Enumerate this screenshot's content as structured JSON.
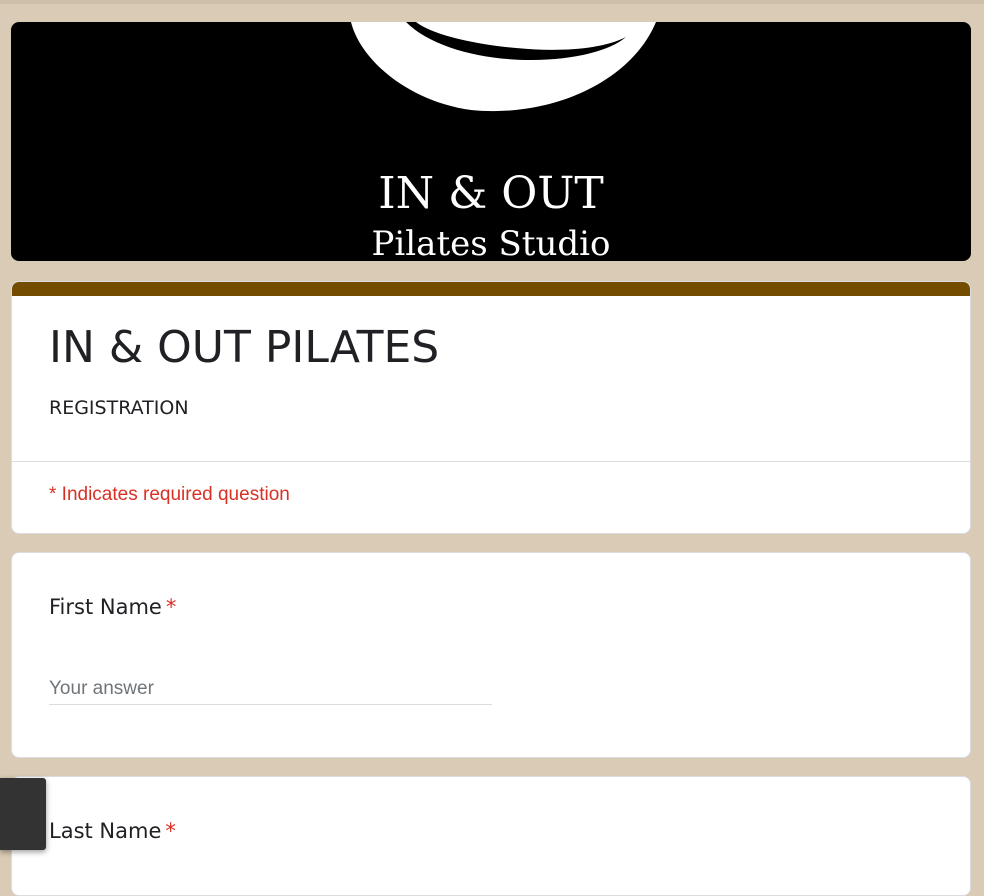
{
  "banner": {
    "line1": "IN & OUT",
    "line2": "Pilates Studio"
  },
  "form": {
    "title": "IN & OUT PILATES",
    "description": "REGISTRATION",
    "required_note": "* Indicates required question"
  },
  "questions": [
    {
      "label": "First Name",
      "required_mark": "*",
      "placeholder": "Your answer"
    },
    {
      "label": "Last Name",
      "required_mark": "*"
    }
  ],
  "colors": {
    "page_background": "#d9cbb5",
    "accent": "#744c00",
    "required": "#d93025",
    "banner_background": "#000000"
  }
}
